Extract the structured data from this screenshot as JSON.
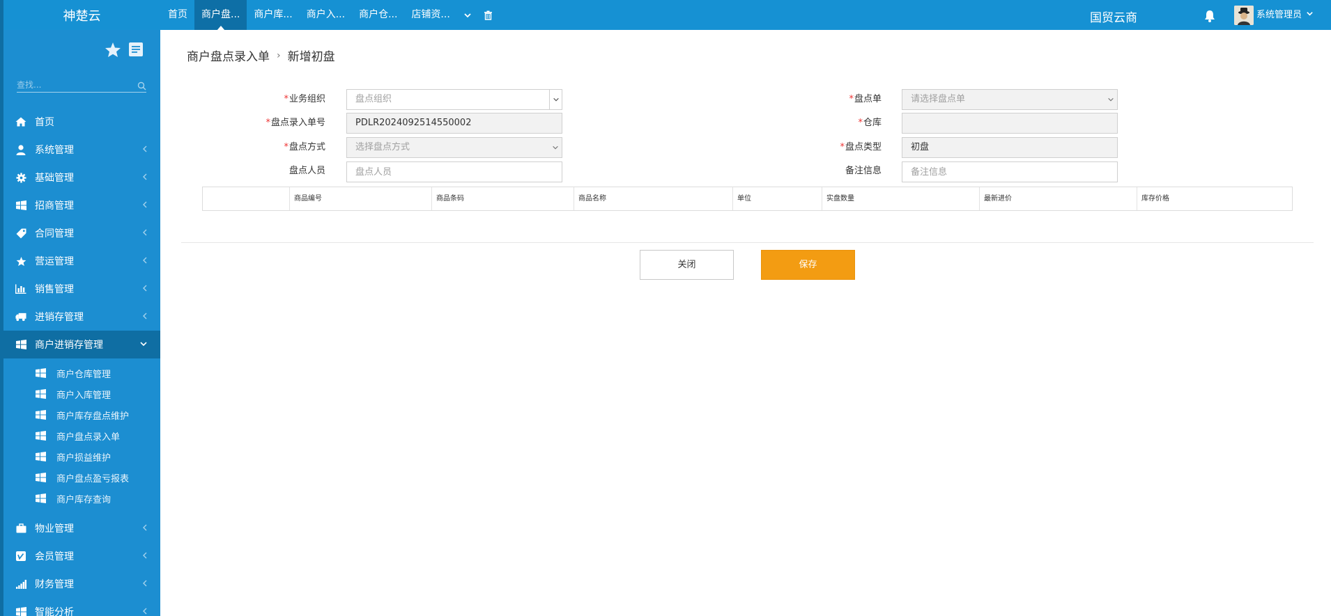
{
  "header": {
    "brand": "神楚云",
    "tabs": [
      "首页",
      "商户盘...",
      "商户库...",
      "商户入...",
      "商户仓...",
      "店铺资..."
    ],
    "active_tab": 1,
    "region": "国贸云商",
    "user": "系统管理员"
  },
  "sidebar": {
    "search_placeholder": "查找...",
    "menu": [
      {
        "label": "首页",
        "icon": "home-icon"
      },
      {
        "label": "系统管理",
        "icon": "user-icon"
      },
      {
        "label": "基础管理",
        "icon": "gear-icon"
      },
      {
        "label": "招商管理",
        "icon": "windows-icon"
      },
      {
        "label": "合同管理",
        "icon": "tag-icon"
      },
      {
        "label": "营运管理",
        "icon": "star-icon"
      },
      {
        "label": "销售管理",
        "icon": "bar-chart-icon"
      },
      {
        "label": "进销存管理",
        "icon": "truck-icon"
      },
      {
        "label": "商户进销存管理",
        "icon": "windows-icon"
      }
    ],
    "submenu": [
      "商户仓库管理",
      "商户入库管理",
      "商户库存盘点维护",
      "商户盘点录入单",
      "商户损益维护",
      "商户盘点盈亏报表",
      "商户库存查询"
    ],
    "menu_after": [
      {
        "label": "物业管理",
        "icon": "briefcase-icon"
      },
      {
        "label": "会员管理",
        "icon": "vimeo-icon"
      },
      {
        "label": "财务管理",
        "icon": "signal-icon"
      },
      {
        "label": "智能分析",
        "icon": "windows-icon"
      }
    ]
  },
  "breadcrumb": {
    "parent": "商户盘点录入单",
    "separator": "›",
    "current": "新增初盘"
  },
  "form": {
    "org_label": "业务组织",
    "org_placeholder": "盘点组织",
    "entry_no_label": "盘点录入单号",
    "entry_no_value": "PDLR2024092514550002",
    "method_label": "盘点方式",
    "method_placeholder": "选择盘点方式",
    "person_label": "盘点人员",
    "person_placeholder": "盘点人员",
    "sheet_label": "盘点单",
    "sheet_placeholder": "请选择盘点单",
    "warehouse_label": "仓库",
    "warehouse_value": "",
    "type_label": "盘点类型",
    "type_value": "初盘",
    "remark_label": "备注信息",
    "remark_placeholder": "备注信息",
    "required_mark": "*"
  },
  "grid": {
    "columns": [
      "",
      "商品编号",
      "商品条码",
      "商品名称",
      "单位",
      "实盘数量",
      "最新进价",
      "库存价格"
    ]
  },
  "buttons": {
    "close": "关闭",
    "save": "保存"
  },
  "colors": {
    "header_bg": "#1691d3",
    "sidebar_bg": "#1c8ed1",
    "active_bg": "#0e6fa6",
    "save_button": "#f39c12",
    "required": "#ee3333"
  }
}
